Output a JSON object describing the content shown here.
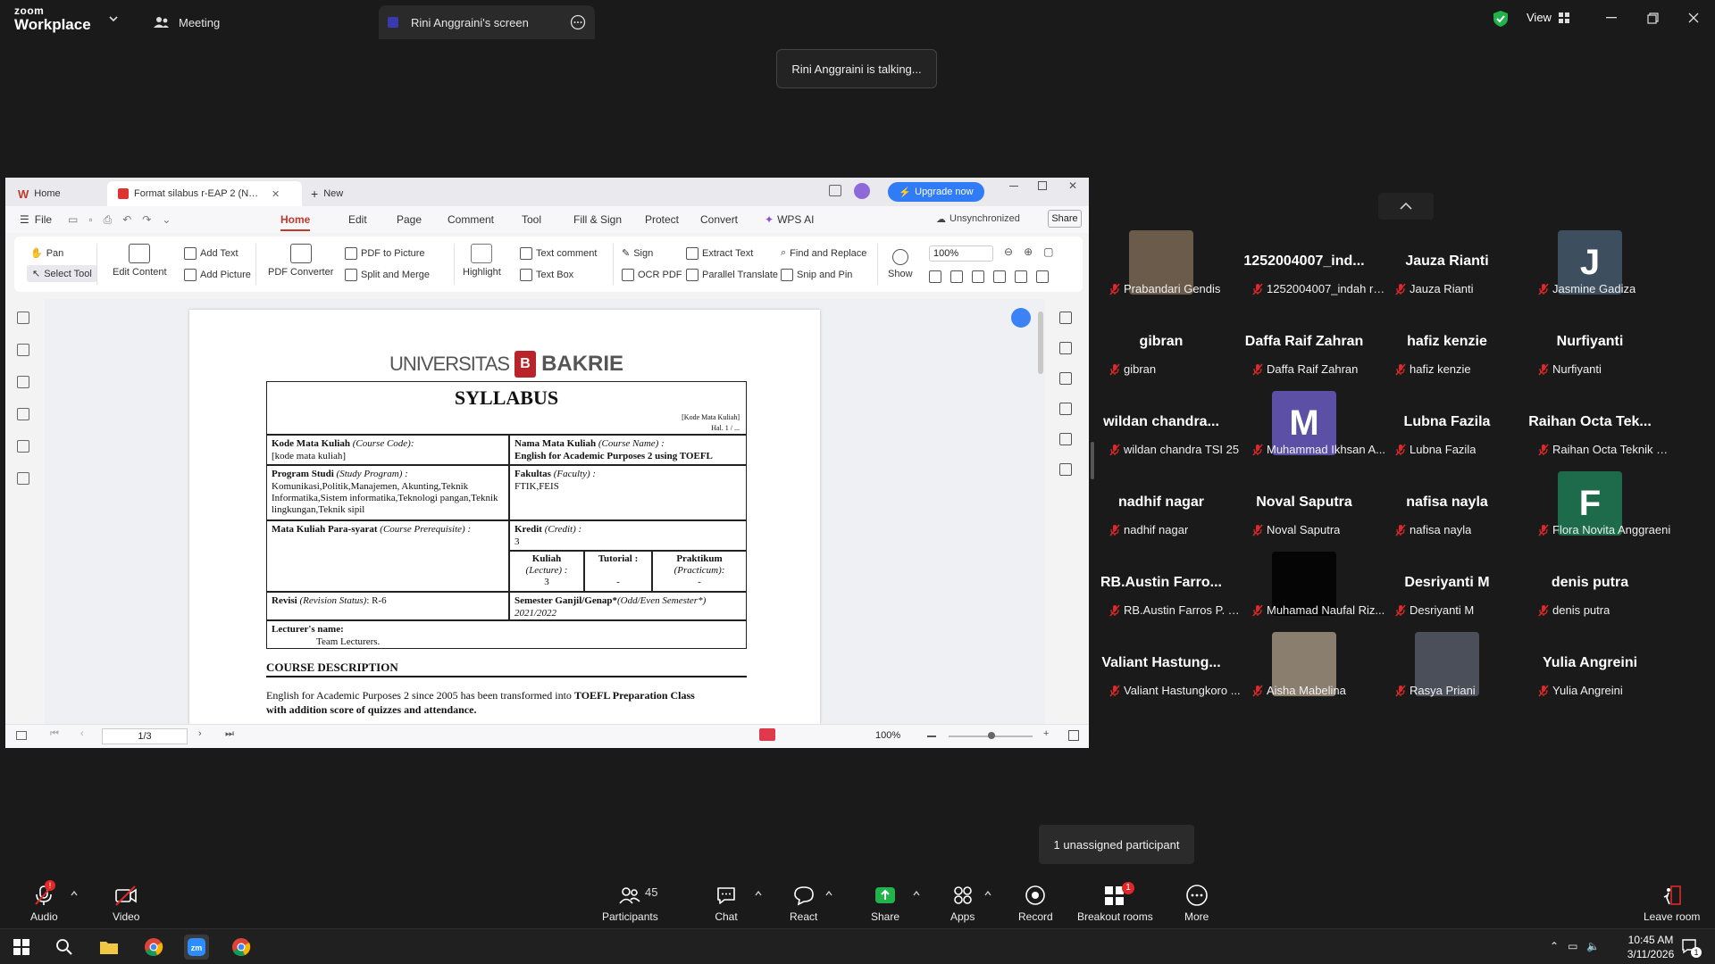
{
  "titlebar": {
    "logo_top": "zoom",
    "logo_bottom": "Workplace",
    "meeting_tab": "Meeting",
    "share_tab": "Rini Anggraini's screen",
    "view_label": "View"
  },
  "talking": "Rini Anggraini is talking...",
  "wps": {
    "tabs": {
      "home": "Home",
      "file": "Format silabus r-EAP 2 (NEW)",
      "new": "New"
    },
    "upgrade": "Upgrade now",
    "menus": [
      "File",
      "Home",
      "Edit",
      "Page",
      "Comment",
      "Tool",
      "Fill & Sign",
      "Protect",
      "Convert",
      "WPS AI"
    ],
    "sync": "Unsynchronized",
    "share": "Share",
    "ribbon": {
      "pan": "Pan",
      "select": "Select Tool",
      "edit_content": "Edit Content",
      "add_text": "Add Text",
      "add_picture": "Add Picture",
      "pdf_converter": "PDF Converter",
      "pdf_to_picture": "PDF to Picture",
      "split_merge": "Split and Merge",
      "highlight": "Highlight",
      "text_comment": "Text comment",
      "text_box": "Text Box",
      "sign": "Sign",
      "ocr": "OCR PDF",
      "extract": "Extract Text",
      "parallel": "Parallel Translate",
      "find_replace": "Find and Replace",
      "snip_pin": "Snip and Pin",
      "show": "Show",
      "zoom": "100%"
    },
    "status": {
      "page": "1/3",
      "zoom": "100%"
    }
  },
  "doc": {
    "univ_left": "UNIVERSITAS",
    "univ_right": "BAKRIE",
    "title": "SYLLABUS",
    "code_label": "[Kode Mata Kuliah]",
    "hal_label": "Hal. 1 / ...",
    "kode_label": "Kode Mata Kuliah",
    "kode_en": "(Course Code):",
    "kode_value": "[kode mata kuliah]",
    "nama_label": "Nama Mata Kuliah",
    "nama_en": "(Course Name) :",
    "nama_value": "English for Academic Purposes 2 using TOEFL",
    "prodi_label": "Program Studi",
    "prodi_en": "(Study Program) :",
    "prodi_value": "Komunikasi,Politik,Manajemen, Akunting,Teknik Informatika,Sistem informatika,Teknologi pangan,Teknik lingkungan,Teknik sipil",
    "fakultas_label": "Fakultas",
    "fakultas_en": "(Faculty) :",
    "fakultas_value": "FTIK,FEIS",
    "prereq_label": "Mata Kuliah Para-syarat",
    "prereq_en": "(Course Prerequisite) :",
    "kredit_label": "Kredit",
    "kredit_en": "(Credit) :",
    "kredit_value": "3",
    "kuliah_label": "Kuliah",
    "kuliah_en": "(Lecture) :",
    "kuliah_value": "3",
    "tutorial_label": "Tutorial :",
    "tutorial_value": "-",
    "praktikum_label": "Praktikum",
    "praktikum_en": "(Practicum):",
    "praktikum_value": "-",
    "revisi_label": "Revisi",
    "revisi_en": "(Revision Status)",
    "revisi_value": ": R-6",
    "semester_label": "Semester Ganjil/Genap*",
    "semester_en": "(Odd/Even Semester*)",
    "semester_value": "2021/2022",
    "lecturer_label": "Lecturer's name:",
    "lecturer_value": "Team Lecturers.",
    "section_title": "COURSE DESCRIPTION",
    "desc_1a": "English for Academic Purposes 2 since 2005 has been transformed into ",
    "desc_1b": "TOEFL Preparation Class",
    "desc_2": "with addition score of quizzes and attendance."
  },
  "participants": [
    {
      "name": "",
      "label": "Prabandari Gendis",
      "avatar": "photo",
      "color": "#6b5b4b"
    },
    {
      "name": "1252004007_ind...",
      "label": "1252004007_indah ra...",
      "avatar": ""
    },
    {
      "name": "Jauza Rianti",
      "label": "Jauza Rianti",
      "avatar": ""
    },
    {
      "name": "",
      "label": "Jasmine Gadiza",
      "avatar": "J",
      "color": "#3d4e5e"
    },
    {
      "name": "gibran",
      "label": "gibran",
      "avatar": ""
    },
    {
      "name": "Daffa Raif Zahran",
      "label": "Daffa Raif Zahran",
      "avatar": ""
    },
    {
      "name": "hafiz kenzie",
      "label": "hafiz kenzie",
      "avatar": ""
    },
    {
      "name": "Nurfiyanti",
      "label": "Nurfiyanti",
      "avatar": ""
    },
    {
      "name": "wildan chandra...",
      "label": "wildan chandra TSI 25",
      "avatar": ""
    },
    {
      "name": "",
      "label": "Muhammad Ikhsan A...",
      "avatar": "M",
      "color": "#5b4fa6"
    },
    {
      "name": "Lubna Fazila",
      "label": "Lubna Fazila",
      "avatar": ""
    },
    {
      "name": "Raihan Octa Tek...",
      "label": "Raihan Octa Teknik Si...",
      "avatar": ""
    },
    {
      "name": "nadhif nagar",
      "label": "nadhif nagar",
      "avatar": ""
    },
    {
      "name": "Noval Saputra",
      "label": "Noval Saputra",
      "avatar": ""
    },
    {
      "name": "nafisa nayla",
      "label": "nafisa nayla",
      "avatar": ""
    },
    {
      "name": "",
      "label": "Flora Novita Anggraeni",
      "avatar": "F",
      "color": "#1d6b4a"
    },
    {
      "name": "RB.Austin Farro...",
      "label": "RB.Austin Farros P. TS...",
      "avatar": ""
    },
    {
      "name": "",
      "label": "Muhamad Naufal Riz...",
      "avatar": "black",
      "color": "#050505"
    },
    {
      "name": "Desriyanti M",
      "label": "Desriyanti M",
      "avatar": ""
    },
    {
      "name": "denis putra",
      "label": "denis putra",
      "avatar": ""
    },
    {
      "name": "Valiant Hastung...",
      "label": "Valiant Hastungkoro ...",
      "avatar": ""
    },
    {
      "name": "",
      "label": "Aisha Mabelina",
      "avatar": "photo",
      "color": "#8a7e6e"
    },
    {
      "name": "",
      "label": "Rasya Priani",
      "avatar": "photo",
      "color": "#4a4f5a"
    },
    {
      "name": "Yulia Angreini",
      "label": "Yulia Angreini",
      "avatar": ""
    }
  ],
  "unassigned": "1 unassigned participant",
  "toolbar": {
    "audio": "Audio",
    "video": "Video",
    "participants": "Participants",
    "participants_count": "45",
    "chat": "Chat",
    "react": "React",
    "share": "Share",
    "apps": "Apps",
    "record": "Record",
    "breakout": "Breakout rooms",
    "breakout_badge": "1",
    "more": "More",
    "leave": "Leave room",
    "audio_badge": "!"
  },
  "taskbar": {
    "time": "10:45 AM",
    "date": "3/11/2026",
    "notif": "1"
  },
  "colors": {
    "share_green": "#21b24b",
    "mute_red": "#e02828",
    "upgrade_blue": "#2f7cf6",
    "wps_red": "#c0392b",
    "bakrie_red": "#b8242a"
  }
}
